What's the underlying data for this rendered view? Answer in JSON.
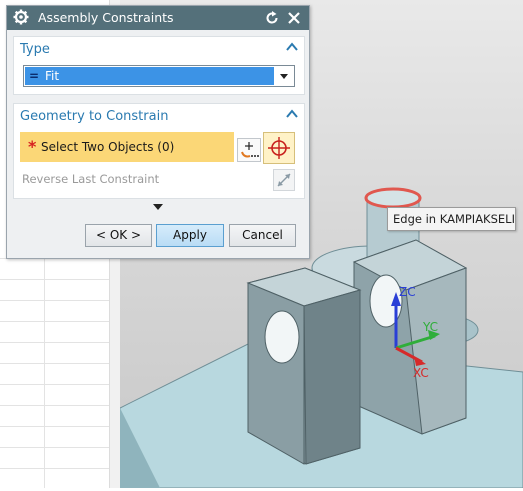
{
  "dialog": {
    "title": "Assembly Constraints",
    "type_section": {
      "header": "Type",
      "selected_icon": "=",
      "selected_value": "Fit"
    },
    "geometry_section": {
      "header": "Geometry to Constrain",
      "required_marker": "*",
      "select_objects_label": "Select Two Objects (0)",
      "reverse_label": "Reverse Last Constraint"
    },
    "buttons": {
      "ok": "< OK >",
      "apply": "Apply",
      "cancel": "Cancel"
    },
    "icons": [
      "gear-icon",
      "reset-icon",
      "close-icon",
      "chevron-up-icon",
      "dropdown-arrow-icon",
      "pick-object-icon",
      "crosshair-target-icon",
      "reverse-constraint-icon",
      "more-options-arrow-icon"
    ]
  },
  "viewport": {
    "tooltip": "Edge in KAMPIAKSELI",
    "axes": {
      "z": "ZC",
      "y": "YC",
      "x": "XC"
    },
    "colors": {
      "z_axis": "#2a3fd6",
      "y_axis": "#2fae3a",
      "x_axis": "#d62a2a",
      "highlight_edge": "#e0584f"
    }
  },
  "colors": {
    "titlebar": "#54707a",
    "accent": "#2a7ab0",
    "selection": "#3c93e6",
    "required_row": "#fbd777"
  }
}
